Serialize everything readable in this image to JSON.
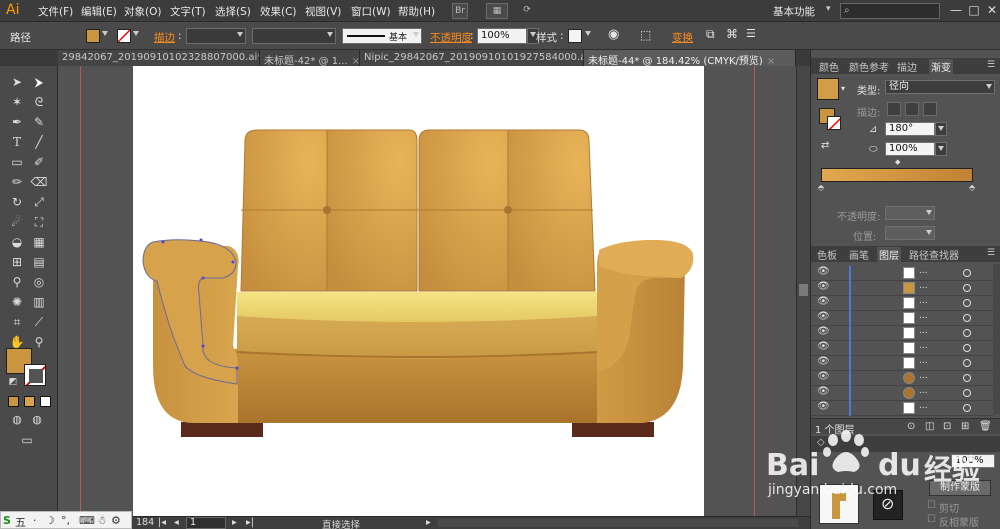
{
  "menubar": {
    "logo": "Ai",
    "items": [
      "文件(F)",
      "编辑(E)",
      "对象(O)",
      "文字(T)",
      "选择(S)",
      "效果(C)",
      "视图(V)",
      "窗口(W)",
      "帮助(H)"
    ],
    "br_label": "Br",
    "workspace": "基本功能",
    "window_buttons": [
      "—",
      "□",
      "✕"
    ]
  },
  "controlbar": {
    "selection_label": "路径",
    "stroke_label": "描边",
    "stroke_sep": ":",
    "profile_label": "基本",
    "opacity_label": "不透明度",
    "opacity_value": "100%",
    "style_label": "样式",
    "transform_label": "变换",
    "fill_color": "#c9953f"
  },
  "tabs": [
    {
      "label": "29842067_20190910102328807000.ai*",
      "close": "×",
      "active": false
    },
    {
      "label": "未标题-42* @ 1...",
      "close": "×",
      "active": false
    },
    {
      "label": "Nipic_29842067_20190910101927584000.ai*",
      "close": "×",
      "active": false
    },
    {
      "label": "未标题-44* @ 184.42% (CMYK/预览)",
      "close": "×",
      "active": true
    }
  ],
  "toolbar": {
    "tools": [
      "selection-tool",
      "direct-selection-tool",
      "magic-wand-tool",
      "lasso-tool",
      "pen-tool",
      "curvature-tool",
      "type-tool",
      "line-tool",
      "rectangle-tool",
      "paintbrush-tool",
      "pencil-tool",
      "eraser-tool",
      "rotate-tool",
      "scale-tool",
      "warp-tool",
      "free-transform-tool",
      "shape-builder-tool",
      "perspective-tool",
      "mesh-tool",
      "gradient-tool",
      "eyedropper-tool",
      "blend-tool",
      "symbol-sprayer-tool",
      "graph-tool",
      "artboard-tool",
      "slice-tool",
      "hand-tool",
      "zoom-tool"
    ],
    "fill_color": "#c9953f"
  },
  "status": {
    "zoom": "184",
    "page": "1",
    "tool_name": "直接选择"
  },
  "ime": {
    "label": "五"
  },
  "panels": {
    "top_tabs": [
      "颜色",
      "颜色参考",
      "描边",
      "渐变"
    ],
    "active_top": "渐变",
    "gradient": {
      "type_label": "类型:",
      "type_value": "径向",
      "stroke_label": "描边:",
      "angle_value": "180°",
      "aspect_value": "100%",
      "opacity_label": "不透明度:",
      "position_label": "位置:",
      "start_color": "#e2a84f",
      "end_color": "#c08236"
    },
    "mid_tabs": [
      "色板",
      "画笔",
      "图层",
      "路径查找器"
    ],
    "active_mid": "图层",
    "layer_rows": [
      {
        "name": "..."
      },
      {
        "name": "..."
      },
      {
        "name": "..."
      },
      {
        "name": "..."
      },
      {
        "name": "..."
      },
      {
        "name": "..."
      },
      {
        "name": "..."
      },
      {
        "name": "..."
      },
      {
        "name": "..."
      },
      {
        "name": "..."
      }
    ],
    "layers_count": "1 个图层",
    "lower_values": [
      "100%"
    ],
    "lower_button": "制作蒙版",
    "lower_options": [
      "剪切",
      "反相蒙版"
    ]
  },
  "watermark": {
    "brand": "Bai",
    "brand2": "du",
    "cn": "经验",
    "url": "jingyan.baidu.com"
  },
  "sofa": {
    "body_color": "#c08a3e",
    "cushion_color": "#f0dc75",
    "leg_color": "#5a2a1c"
  }
}
